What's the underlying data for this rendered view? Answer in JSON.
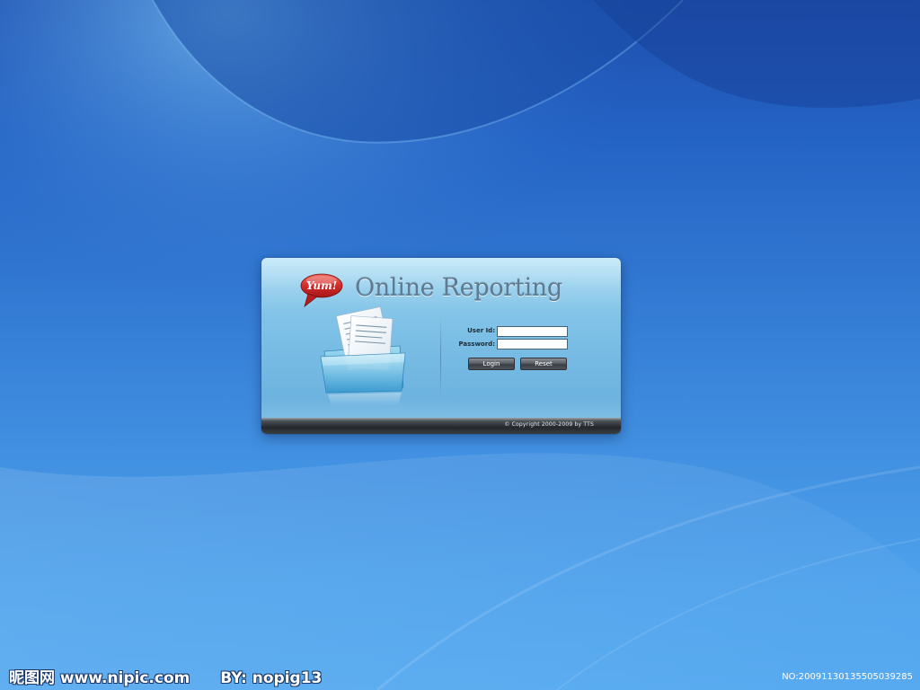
{
  "login_panel": {
    "brand_badge": "Yum!",
    "app_title": "Online Reporting",
    "user_id_label": "User Id:",
    "password_label": "Password:",
    "user_id_value": "",
    "password_value": "",
    "login_button": "Login",
    "reset_button": "Reset",
    "copyright": "© Copyright 2000-2009 by TTS",
    "folder_icon": "documents-folder-icon"
  },
  "watermark": {
    "site_text": "昵图网 www.nipic.com",
    "author_text": "BY: nopig13",
    "image_number": "NO:20091130135505039285"
  },
  "colors": {
    "background_top": "#1e4fae",
    "background_bottom": "#57aaf0",
    "panel": "#79bde5",
    "logo_red": "#d42a2a",
    "button": "#4d5258"
  }
}
